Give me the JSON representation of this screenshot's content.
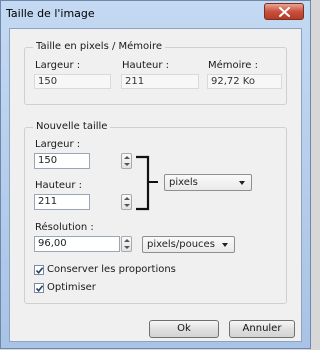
{
  "window": {
    "title": "Taille de l'image"
  },
  "memory_group": {
    "legend": "Taille en pixels / Mémoire",
    "width_label": "Largeur :",
    "width_value": "150",
    "height_label": "Hauteur :",
    "height_value": "211",
    "memory_label": "Mémoire :",
    "memory_value": "92,72 Ko"
  },
  "new_size_group": {
    "legend": "Nouvelle taille",
    "width_label": "Largeur :",
    "width_value": "150",
    "height_label": "Hauteur :",
    "height_value": "211",
    "unit_selected": "pixels",
    "resolution_label": "Résolution :",
    "resolution_value": "96,00",
    "resolution_unit_selected": "pixels/pouces",
    "keep_proportions_label": "Conserver les proportions",
    "keep_proportions_checked": true,
    "optimize_label": "Optimiser",
    "optimize_checked": true
  },
  "buttons": {
    "ok": "Ok",
    "cancel": "Annuler"
  },
  "icons": {
    "close": "close-icon",
    "spin_up": "spin-up-icon",
    "spin_down": "spin-down-icon",
    "dropdown": "chevron-down-icon",
    "checkmark": "checkmark-icon",
    "link_bracket": "link-bracket-icon"
  },
  "colors": {
    "close_button": "#c9503c",
    "window_frame": "#a8c3e6",
    "client_bg": "#f0f0f0"
  }
}
